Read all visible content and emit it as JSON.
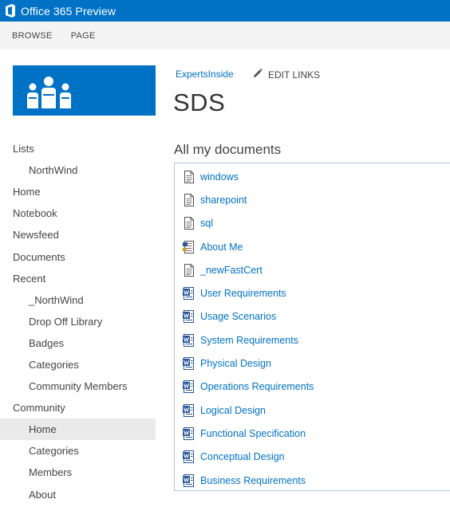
{
  "suite_bar": {
    "title": "Office 365 Preview"
  },
  "ribbon": {
    "tabs": [
      "BROWSE",
      "PAGE"
    ]
  },
  "header": {
    "breadcrumb": "ExpertsInside",
    "edit_links": "EDIT LINKS",
    "title": "SDS"
  },
  "quick_launch": {
    "items": [
      {
        "label": "Lists",
        "level": 0
      },
      {
        "label": "NorthWind",
        "level": 1
      },
      {
        "label": "Home",
        "level": 0
      },
      {
        "label": "Notebook",
        "level": 0
      },
      {
        "label": "Newsfeed",
        "level": 0
      },
      {
        "label": "Documents",
        "level": 0
      },
      {
        "label": "Recent",
        "level": 0
      },
      {
        "label": "_NorthWind",
        "level": 1
      },
      {
        "label": "Drop Off Library",
        "level": 1
      },
      {
        "label": "Badges",
        "level": 1
      },
      {
        "label": "Categories",
        "level": 1
      },
      {
        "label": "Community Members",
        "level": 1
      },
      {
        "label": "Community",
        "level": 0
      },
      {
        "label": "Home",
        "level": 1,
        "selected": true
      },
      {
        "label": "Categories",
        "level": 1
      },
      {
        "label": "Members",
        "level": 1
      },
      {
        "label": "About",
        "level": 1
      }
    ]
  },
  "documents": {
    "title": "All my documents",
    "items": [
      {
        "name": "windows",
        "icon": "text-document-icon"
      },
      {
        "name": "sharepoint",
        "icon": "text-document-icon"
      },
      {
        "name": "sql",
        "icon": "text-document-icon"
      },
      {
        "name": "About Me",
        "icon": "webpart-page-icon"
      },
      {
        "name": "_newFastCert",
        "icon": "text-document-icon"
      },
      {
        "name": "User Requirements",
        "icon": "word-document-icon"
      },
      {
        "name": "Usage Scenarios",
        "icon": "word-document-icon"
      },
      {
        "name": "System Requirements",
        "icon": "word-document-icon"
      },
      {
        "name": "Physical Design",
        "icon": "word-document-icon"
      },
      {
        "name": "Operations Requirements",
        "icon": "word-document-icon"
      },
      {
        "name": "Logical Design",
        "icon": "word-document-icon"
      },
      {
        "name": "Functional Specification",
        "icon": "word-document-icon"
      },
      {
        "name": "Conceptual Design",
        "icon": "word-document-icon"
      },
      {
        "name": "Business Requirements",
        "icon": "word-document-icon"
      }
    ]
  },
  "colors": {
    "brand": "#0072c6",
    "link": "#0072c6",
    "selected_bg": "#eaeaea",
    "ribbon_bg": "#f4f4f4"
  }
}
